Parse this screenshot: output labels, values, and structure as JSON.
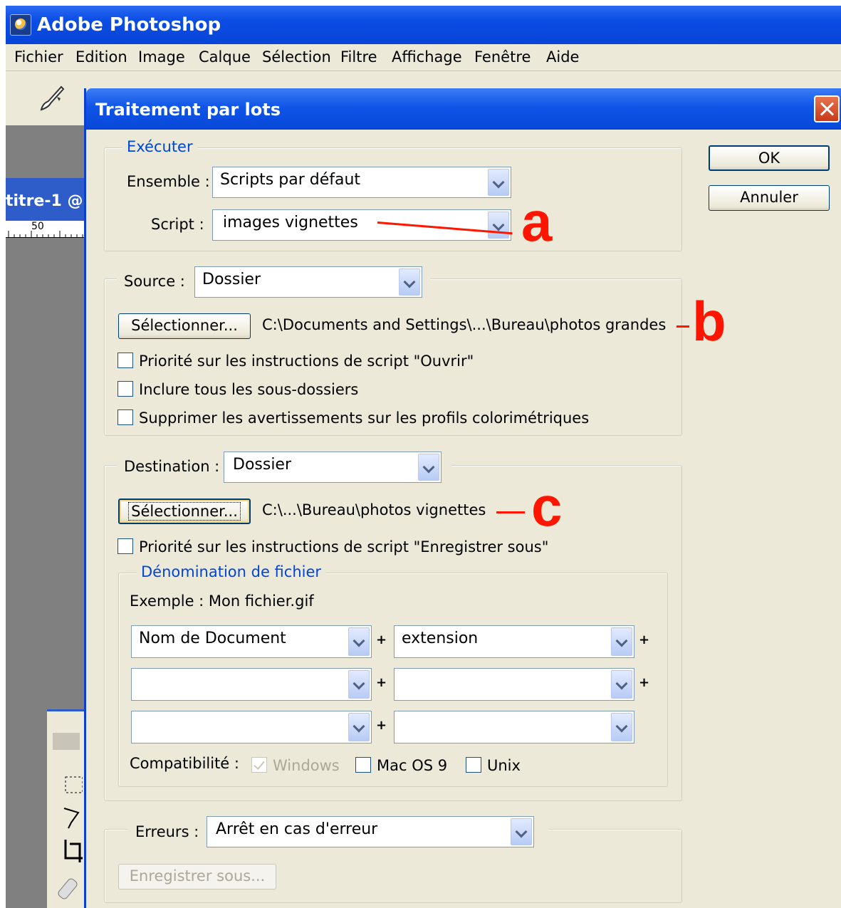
{
  "app": {
    "title": "Adobe Photoshop",
    "menu": [
      "Fichier",
      "Edition",
      "Image",
      "Calque",
      "Sélection",
      "Filtre",
      "Affichage",
      "Fenêtre",
      "Aide"
    ],
    "document_tab": "titre-1 @",
    "ruler_tick": "50"
  },
  "dialog": {
    "title": "Traitement par lots",
    "ok_label": "OK",
    "cancel_label": "Annuler",
    "executer": {
      "legend": "Exécuter",
      "ensemble_label": "Ensemble :",
      "ensemble_value": "Scripts par défaut",
      "script_label": "Script :",
      "script_value": "images vignettes"
    },
    "source": {
      "label": "Source :",
      "value": "Dossier",
      "select_button": "Sélectionner...",
      "path": "C:\\Documents and Settings\\...\\Bureau\\photos grandes",
      "checkboxes": [
        "Priorité sur les instructions de script \"Ouvrir\"",
        "Inclure tous les sous-dossiers",
        "Supprimer les avertissements sur les profils colorimétriques"
      ]
    },
    "destination": {
      "label": "Destination :",
      "value": "Dossier",
      "select_button": "Sélectionner...",
      "path": "C:\\...\\Bureau\\photos vignettes",
      "override_checkbox": "Priorité sur les instructions de script \"Enregistrer sous\"",
      "naming": {
        "legend": "Dénomination de fichier",
        "example": "Exemple : Mon fichier.gif",
        "fields": [
          "Nom de Document",
          "extension",
          "",
          "",
          "",
          ""
        ],
        "plus": "+",
        "compat_label": "Compatibilité :",
        "compat_windows": "Windows",
        "compat_mac": "Mac OS 9",
        "compat_unix": "Unix"
      }
    },
    "errors": {
      "label": "Erreurs :",
      "value": "Arrêt en cas d'erreur",
      "save_as_button": "Enregistrer sous..."
    }
  },
  "annotations": {
    "a": "a",
    "b": "b",
    "c": "c",
    "color": "#ff1500"
  }
}
